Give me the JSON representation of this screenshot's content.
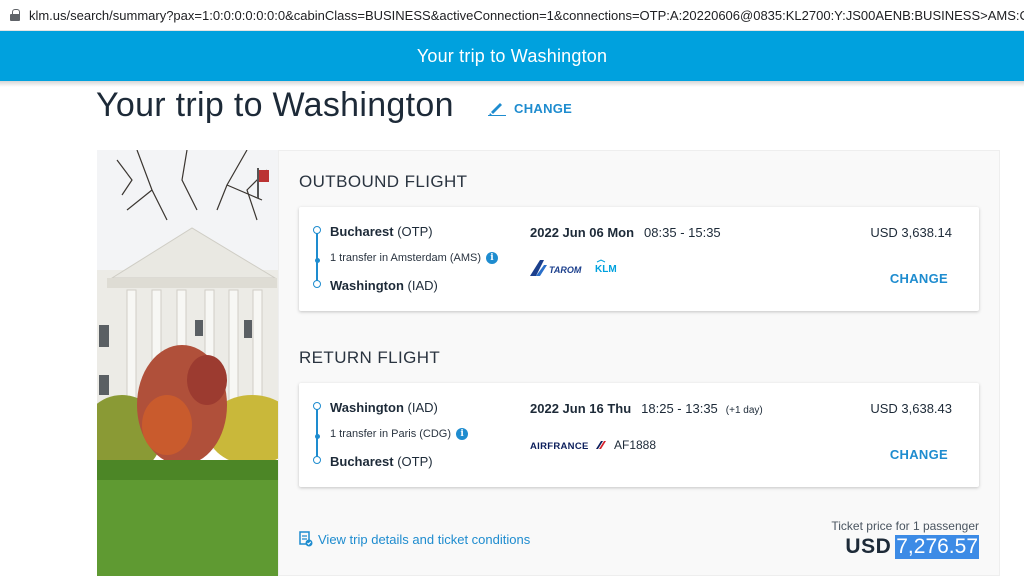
{
  "browser": {
    "url": "klm.us/search/summary?pax=1:0:0:0:0:0:0:0&cabinClass=BUSINESS&activeConnection=1&connections=OTP:A:20220606@0835:KL2700:Y:JS00AENB:BUSINESS>AMS:C:20220606@..."
  },
  "header": {
    "title": "Your trip to Washington"
  },
  "page": {
    "title": "Your trip to Washington",
    "change_label": "CHANGE"
  },
  "outbound": {
    "section_title": "OUTBOUND FLIGHT",
    "from_city": "Bucharest",
    "from_code": "(OTP)",
    "transfer": "1 transfer in Amsterdam (AMS)",
    "to_city": "Washington",
    "to_code": "(IAD)",
    "date": "2022 Jun 06 Mon",
    "time": "08:35 - 15:35",
    "price": "USD 3,638.14",
    "carriers": [
      "TAROM",
      "KLM"
    ],
    "change_label": "CHANGE"
  },
  "return": {
    "section_title": "RETURN FLIGHT",
    "from_city": "Washington",
    "from_code": "(IAD)",
    "transfer": "1 transfer in Paris (CDG)",
    "to_city": "Bucharest",
    "to_code": "(OTP)",
    "date": "2022 Jun 16 Thu",
    "time": "18:25 - 13:35",
    "day_offset": "(+1 day)",
    "price": "USD 3,638.43",
    "carrier": "AIRFRANCE",
    "flight_number": "AF1888",
    "change_label": "CHANGE"
  },
  "footer": {
    "details_link": "View trip details and ticket conditions",
    "ticket_label": "Ticket price for 1 passenger",
    "total_currency": "USD",
    "total_amount": "7,276.57"
  },
  "colors": {
    "brand": "#00a1de",
    "link": "#1e8ccf",
    "text": "#1d2a38"
  }
}
